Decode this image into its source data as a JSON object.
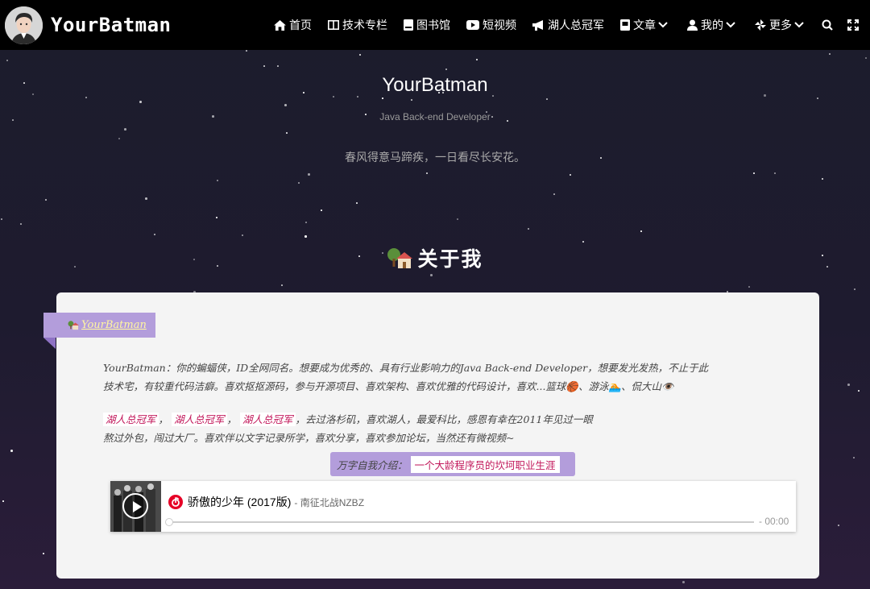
{
  "brand": {
    "name": "YourBatman"
  },
  "nav": {
    "items": [
      {
        "label": "首页",
        "icon": "home-icon"
      },
      {
        "label": "技术专栏",
        "icon": "columns-icon"
      },
      {
        "label": "图书馆",
        "icon": "book-icon"
      },
      {
        "label": "短视频",
        "icon": "youtube-icon"
      },
      {
        "label": "湖人总冠军",
        "icon": "bullhorn-icon"
      },
      {
        "label": "文章",
        "icon": "archive-icon",
        "dropdown": true
      },
      {
        "label": "我的",
        "icon": "user-icon",
        "dropdown": true
      },
      {
        "label": "更多",
        "icon": "pinwheel-icon",
        "dropdown": true
      }
    ],
    "search_icon": "search-icon",
    "fullscreen_icon": "expand-icon"
  },
  "hero": {
    "title": "YourBatman",
    "subtitle": "Java Back-end Developer",
    "motto": "春风得意马蹄疾，一日看尽长安花。"
  },
  "about": {
    "heading": "关于我",
    "ribbon_link": "YourBatman",
    "para1_line1": "YourBatman：你的蝙蝠侠，ID全网同名。想要成为优秀的、具有行业影响力的Java Back-end Developer，想要发光发热，不止于此",
    "para1_line2": "技术宅，有较重代码洁癖。喜欢抠抠源码，参与开源项目、喜欢架构、喜欢优雅的代码设计，喜欢...篮球🏀、游泳🏊、侃大山👁️",
    "tag1": "湖人总冠军",
    "tag2": "湖人总冠军",
    "tag3": "湖人总冠军",
    "sep": "，",
    "para2_line1_rest": "，去过洛杉矶，喜欢湖人，最爱科比，感恩有幸在2011年见过一眼",
    "para2_line2": "熬过外包，闯过大厂。喜欢伴以文字记录所学，喜欢分享，喜欢参加论坛，当然还有微视频~",
    "intro_label": "万字自我介绍：",
    "intro_link": "一个大龄程序员的坎坷职业生涯"
  },
  "player": {
    "song_title": "骄傲的少年 (2017版)",
    "artist": "- 南征北战NZBZ",
    "time": "- 00:00",
    "progress": 0
  },
  "colors": {
    "accent_purple": "#b39ddb",
    "highlight_pink": "#c2185b",
    "netease_red": "#e60026"
  }
}
